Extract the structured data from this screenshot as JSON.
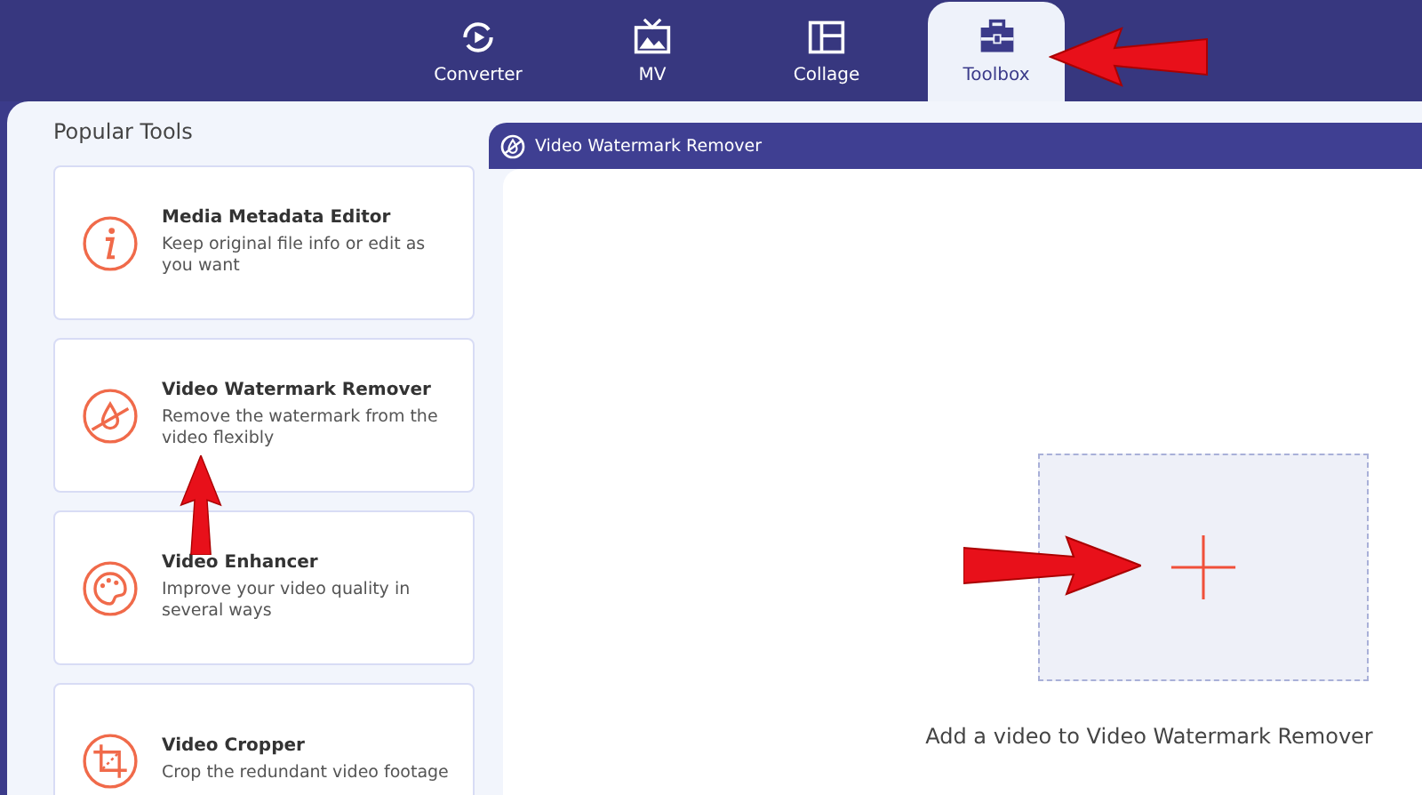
{
  "tabs": [
    {
      "label": "Converter",
      "kind": "converter",
      "selected": false
    },
    {
      "label": "MV",
      "kind": "mv",
      "selected": false
    },
    {
      "label": "Collage",
      "kind": "collage",
      "selected": false
    },
    {
      "label": "Toolbox",
      "kind": "toolbox",
      "selected": true
    }
  ],
  "sidebar": {
    "title": "Popular Tools",
    "items": [
      {
        "kind": "info",
        "title": "Media Metadata Editor",
        "description": "Keep original file info or edit as you want"
      },
      {
        "kind": "watermark",
        "title": "Video Watermark Remover",
        "description": "Remove the watermark from the video flexibly"
      },
      {
        "kind": "palette",
        "title": "Video Enhancer",
        "description": "Improve your video quality in several ways"
      },
      {
        "kind": "crop",
        "title": "Video Cropper",
        "description": "Crop the redundant video footage"
      }
    ]
  },
  "panel": {
    "title": "Video Watermark Remover",
    "hint": "Add a video to Video Watermark Remover"
  }
}
